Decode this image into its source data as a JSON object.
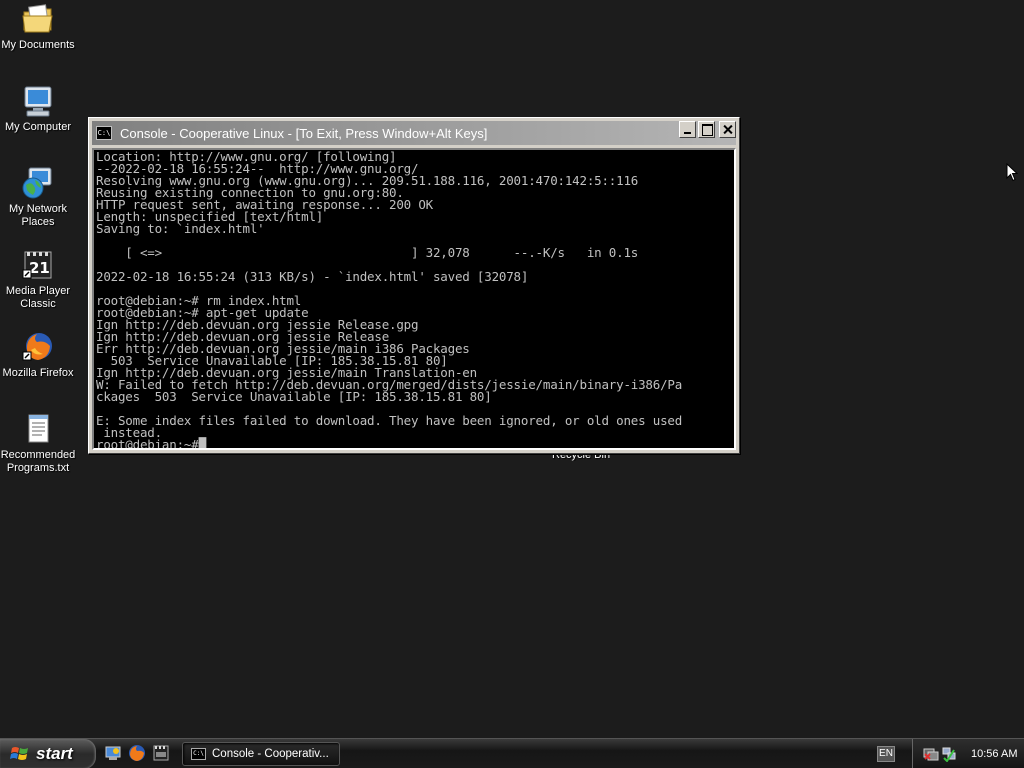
{
  "desktop": {
    "icons": [
      {
        "label": "My Documents"
      },
      {
        "label": "My Computer"
      },
      {
        "label": "My Network Places"
      },
      {
        "label": "Media Player Classic"
      },
      {
        "label": "Mozilla Firefox"
      },
      {
        "label": "Recommended Programs.txt"
      }
    ],
    "recycle_bin_label": "Recycle Bin"
  },
  "console_window": {
    "icon_text": "C:\\",
    "title": "Console - Cooperative Linux - [To Exit, Press Window+Alt Keys]",
    "lines": [
      "Location: http://www.gnu.org/ [following]",
      "--2022-02-18 16:55:24--  http://www.gnu.org/",
      "Resolving www.gnu.org (www.gnu.org)... 209.51.188.116, 2001:470:142:5::116",
      "Reusing existing connection to gnu.org:80.",
      "HTTP request sent, awaiting response... 200 OK",
      "Length: unspecified [text/html]",
      "Saving to: `index.html'",
      "",
      "    [ <=>                                  ] 32,078      --.-K/s   in 0.1s",
      "",
      "2022-02-18 16:55:24 (313 KB/s) - `index.html' saved [32078]",
      "",
      "root@debian:~# rm index.html",
      "root@debian:~# apt-get update",
      "Ign http://deb.devuan.org jessie Release.gpg",
      "Ign http://deb.devuan.org jessie Release",
      "Err http://deb.devuan.org jessie/main i386 Packages",
      "  503  Service Unavailable [IP: 185.38.15.81 80]",
      "Ign http://deb.devuan.org jessie/main Translation-en",
      "W: Failed to fetch http://deb.devuan.org/merged/dists/jessie/main/binary-i386/Pa",
      "ckages  503  Service Unavailable [IP: 185.38.15.81 80]",
      "",
      "E: Some index files failed to download. They have been ignored, or old ones used",
      " instead.",
      "root@debian:~#"
    ]
  },
  "taskbar": {
    "start_label": "start",
    "task_button_label": "Console - Cooperativ...",
    "task_button_icon_text": "C:\\",
    "language": "EN",
    "clock": "10:56 AM"
  },
  "icons": {
    "my_documents": "folder-documents-icon",
    "my_computer": "computer-icon",
    "network": "network-globe-icon",
    "media_player": "media-player-classic-icon",
    "firefox": "firefox-icon",
    "text_file": "notepad-text-file-icon"
  }
}
